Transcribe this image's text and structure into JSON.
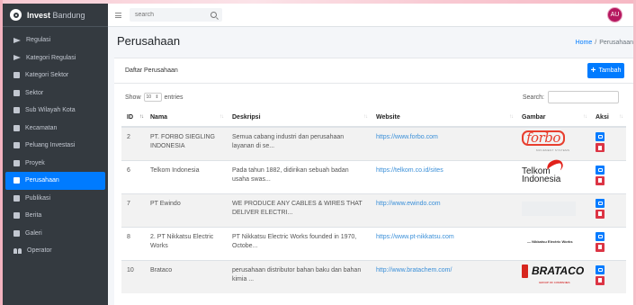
{
  "app": {
    "brand_bold": "Invest",
    "brand_light": "Bandung"
  },
  "sidebar": {
    "items": [
      {
        "label": "Regulasi",
        "icon": "plane-icon",
        "active": false
      },
      {
        "label": "Kategori Regulasi",
        "icon": "plane-icon",
        "active": false
      },
      {
        "label": "Kategori Sektor",
        "icon": "book-icon",
        "active": false
      },
      {
        "label": "Sektor",
        "icon": "book-icon",
        "active": false
      },
      {
        "label": "Sub Wilayah Kota",
        "icon": "book-icon",
        "active": false
      },
      {
        "label": "Kecamatan",
        "icon": "book-icon",
        "active": false
      },
      {
        "label": "Peluang Investasi",
        "icon": "book-icon",
        "active": false
      },
      {
        "label": "Proyek",
        "icon": "book-icon",
        "active": false
      },
      {
        "label": "Perusahaan",
        "icon": "book-icon",
        "active": true
      },
      {
        "label": "Publikasi",
        "icon": "book-icon",
        "active": false
      },
      {
        "label": "Berita",
        "icon": "book-icon",
        "active": false
      },
      {
        "label": "Galeri",
        "icon": "book-icon",
        "active": false
      },
      {
        "label": "Operator",
        "icon": "users-icon",
        "active": false
      }
    ]
  },
  "navbar": {
    "search_placeholder": "search",
    "avatar_initials": "AU"
  },
  "header": {
    "title": "Perusahaan",
    "breadcrumb_home": "Home",
    "breadcrumb_sep": "/",
    "breadcrumb_current": "Perusahaan"
  },
  "card": {
    "title": "Daftar Perusahaan",
    "add_button": "Tambah",
    "show_label": "Show",
    "entries_value": "10",
    "entries_label": "entries",
    "search_label": "Search:"
  },
  "table": {
    "headers": [
      "ID",
      "Nama",
      "Deskripsi",
      "Website",
      "Gambar",
      "Aksi"
    ],
    "rows": [
      {
        "id": "2",
        "nama": "PT. FORBO SIEGLING INDONESIA",
        "deskripsi": "Semua cabang industri dan perusahaan layanan di se...",
        "website": "https://www.forbo.com",
        "logo": "forbo"
      },
      {
        "id": "6",
        "nama": "Telkom Indonesia",
        "deskripsi": "Pada tahun 1882, didirikan sebuah badan usaha swas...",
        "website": "https://telkom.co.id/sites",
        "logo": "telkom"
      },
      {
        "id": "7",
        "nama": "PT Ewindo",
        "deskripsi": "WE PRODUCE ANY CABLES & WIRES THAT DELIVER ELECTRI...",
        "website": "http://www.ewindo.com",
        "logo": "ewindo"
      },
      {
        "id": "8",
        "nama": "2. PT Nikkatsu Electric Works",
        "deskripsi": "PT Nikkatsu Electric Works founded in 1970, Octobe...",
        "website": "https://www.pt-nikkatsu.com",
        "logo": "nikkatsu"
      },
      {
        "id": "10",
        "nama": "Brataco",
        "deskripsi": "perusahaan distributor bahan baku dan bahan kimia ...",
        "website": "http://www.bratachem.com/",
        "logo": "brataco"
      }
    ]
  },
  "logos": {
    "forbo_word": "forbo",
    "forbo_sub": "MOVEMENT SYSTEMS",
    "telkom_word_1": "Telkom",
    "telkom_word_2": "Indonesia",
    "nikkatsu_text": "— Nikkatsu Electric Works",
    "brataco_word": "BRATACO",
    "brataco_sub": "GROUP OF COMPANIES"
  },
  "colors": {
    "primary": "#007bff",
    "danger": "#dc3545",
    "sidebar": "#343a40",
    "avatar": "#b5175f"
  }
}
